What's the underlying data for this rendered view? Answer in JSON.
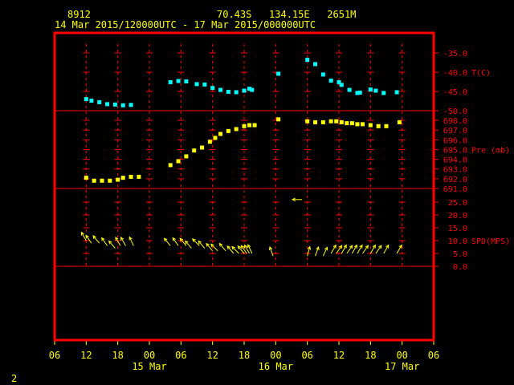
{
  "header": {
    "station_id": "8912",
    "location": "70.43S   134.15E   2651M",
    "time_range": "14 Mar 2015/120000UTC - 17 Mar 2015/000000UTC"
  },
  "footer": {
    "page_number": "2"
  },
  "colors": {
    "frame": "#ff0000",
    "axis_text": "#ffff00",
    "panel_text": "#ff0000",
    "temperature": "#00ffff",
    "pressure": "#ffff00",
    "wind": "#ffff00",
    "background": "#000000"
  },
  "chart_data": {
    "type": "scatter",
    "grid": true,
    "x_axis": {
      "unit": "hours UTC",
      "range": [
        "2015-03-14 06:00",
        "2015-03-17 06:00"
      ],
      "ticks": [
        {
          "time": "2015-03-14 06:00",
          "label": "06"
        },
        {
          "time": "2015-03-14 12:00",
          "label": "12"
        },
        {
          "time": "2015-03-14 18:00",
          "label": "18"
        },
        {
          "time": "2015-03-15 00:00",
          "label": "00"
        },
        {
          "time": "2015-03-15 06:00",
          "label": "06"
        },
        {
          "time": "2015-03-15 12:00",
          "label": "12"
        },
        {
          "time": "2015-03-15 18:00",
          "label": "18"
        },
        {
          "time": "2015-03-16 00:00",
          "label": "00"
        },
        {
          "time": "2015-03-16 06:00",
          "label": "06"
        },
        {
          "time": "2015-03-16 12:00",
          "label": "12"
        },
        {
          "time": "2015-03-16 18:00",
          "label": "18"
        },
        {
          "time": "2015-03-17 00:00",
          "label": "00"
        },
        {
          "time": "2015-03-17 06:00",
          "label": "06"
        }
      ],
      "date_labels": [
        {
          "time": "2015-03-15 00:00",
          "label": "15 Mar"
        },
        {
          "time": "2015-03-16 00:00",
          "label": "16 Mar"
        },
        {
          "time": "2015-03-17 00:00",
          "label": "17 Mar"
        }
      ]
    },
    "panels": [
      {
        "key": "temperature",
        "label": "T(C)",
        "ylim": [
          -50,
          -33
        ],
        "ticks": [
          -35,
          -40,
          -45,
          -50
        ],
        "tick_labels": [
          "-35.0",
          "-40.0",
          "-45.0",
          "-50.0"
        ],
        "series": [
          {
            "time": "2015-03-14 12:00",
            "value": -47.0
          },
          {
            "time": "2015-03-14 13:00",
            "value": -47.4
          },
          {
            "time": "2015-03-14 14:30",
            "value": -47.8
          },
          {
            "time": "2015-03-14 16:00",
            "value": -48.3
          },
          {
            "time": "2015-03-14 17:30",
            "value": -48.4
          },
          {
            "time": "2015-03-14 19:00",
            "value": -48.6
          },
          {
            "time": "2015-03-14 20:30",
            "value": -48.5
          },
          {
            "time": "2015-03-15 04:00",
            "value": -42.6
          },
          {
            "time": "2015-03-15 05:30",
            "value": -42.3
          },
          {
            "time": "2015-03-15 07:00",
            "value": -42.4
          },
          {
            "time": "2015-03-15 09:00",
            "value": -43.1
          },
          {
            "time": "2015-03-15 10:30",
            "value": -43.2
          },
          {
            "time": "2015-03-15 12:00",
            "value": -44.1
          },
          {
            "time": "2015-03-15 13:30",
            "value": -44.6
          },
          {
            "time": "2015-03-15 15:00",
            "value": -45.1
          },
          {
            "time": "2015-03-15 16:30",
            "value": -45.2
          },
          {
            "time": "2015-03-15 18:00",
            "value": -44.8
          },
          {
            "time": "2015-03-15 19:00",
            "value": -44.3
          },
          {
            "time": "2015-03-15 19:30",
            "value": -44.6
          },
          {
            "time": "2015-03-16 00:30",
            "value": -40.4
          },
          {
            "time": "2015-03-16 06:00",
            "value": -36.8
          },
          {
            "time": "2015-03-16 07:30",
            "value": -37.9
          },
          {
            "time": "2015-03-16 09:00",
            "value": -40.6
          },
          {
            "time": "2015-03-16 10:30",
            "value": -42.2
          },
          {
            "time": "2015-03-16 12:00",
            "value": -42.6
          },
          {
            "time": "2015-03-16 12:30",
            "value": -43.3
          },
          {
            "time": "2015-03-16 14:00",
            "value": -44.6
          },
          {
            "time": "2015-03-16 15:30",
            "value": -45.4
          },
          {
            "time": "2015-03-16 16:00",
            "value": -45.3
          },
          {
            "time": "2015-03-16 18:00",
            "value": -44.5
          },
          {
            "time": "2015-03-16 19:00",
            "value": -44.8
          },
          {
            "time": "2015-03-16 20:30",
            "value": -45.4
          },
          {
            "time": "2015-03-16 23:00",
            "value": -45.2
          }
        ]
      },
      {
        "key": "pressure",
        "label": "Pre (mb)",
        "ylim": [
          691,
          698.5
        ],
        "ticks": [
          698,
          697,
          696,
          695,
          694,
          693,
          692,
          691
        ],
        "tick_labels": [
          "698.0",
          "697.0",
          "696.0",
          "695.0",
          "694.0",
          "693.0",
          "692.0",
          "691.0"
        ],
        "series": [
          {
            "time": "2015-03-14 12:00",
            "value": 692.1
          },
          {
            "time": "2015-03-14 13:30",
            "value": 691.8
          },
          {
            "time": "2015-03-14 15:00",
            "value": 691.8
          },
          {
            "time": "2015-03-14 16:30",
            "value": 691.8
          },
          {
            "time": "2015-03-14 18:00",
            "value": 691.9
          },
          {
            "time": "2015-03-14 19:00",
            "value": 692.1
          },
          {
            "time": "2015-03-14 20:30",
            "value": 692.2
          },
          {
            "time": "2015-03-14 22:00",
            "value": 692.2
          },
          {
            "time": "2015-03-15 04:00",
            "value": 693.4
          },
          {
            "time": "2015-03-15 05:30",
            "value": 693.8
          },
          {
            "time": "2015-03-15 07:00",
            "value": 694.3
          },
          {
            "time": "2015-03-15 08:30",
            "value": 694.9
          },
          {
            "time": "2015-03-15 10:00",
            "value": 695.2
          },
          {
            "time": "2015-03-15 11:30",
            "value": 695.8
          },
          {
            "time": "2015-03-15 12:30",
            "value": 696.2
          },
          {
            "time": "2015-03-15 13:30",
            "value": 696.6
          },
          {
            "time": "2015-03-15 15:00",
            "value": 696.9
          },
          {
            "time": "2015-03-15 16:30",
            "value": 697.1
          },
          {
            "time": "2015-03-15 18:00",
            "value": 697.4
          },
          {
            "time": "2015-03-15 19:00",
            "value": 697.5
          },
          {
            "time": "2015-03-15 20:00",
            "value": 697.5
          },
          {
            "time": "2015-03-16 00:30",
            "value": 698.1
          },
          {
            "time": "2015-03-16 06:00",
            "value": 697.9
          },
          {
            "time": "2015-03-16 07:30",
            "value": 697.8
          },
          {
            "time": "2015-03-16 09:00",
            "value": 697.8
          },
          {
            "time": "2015-03-16 10:30",
            "value": 697.9
          },
          {
            "time": "2015-03-16 11:30",
            "value": 697.9
          },
          {
            "time": "2015-03-16 12:30",
            "value": 697.8
          },
          {
            "time": "2015-03-16 13:30",
            "value": 697.7
          },
          {
            "time": "2015-03-16 14:30",
            "value": 697.7
          },
          {
            "time": "2015-03-16 15:30",
            "value": 697.6
          },
          {
            "time": "2015-03-16 16:30",
            "value": 697.6
          },
          {
            "time": "2015-03-16 18:00",
            "value": 697.5
          },
          {
            "time": "2015-03-16 19:30",
            "value": 697.4
          },
          {
            "time": "2015-03-16 21:00",
            "value": 697.4
          },
          {
            "time": "2015-03-16 23:30",
            "value": 697.8
          }
        ]
      },
      {
        "key": "wind",
        "label": "SPD(MPS)",
        "ylim": [
          0,
          29
        ],
        "ticks": [
          25,
          20,
          15,
          10,
          5,
          0
        ],
        "tick_labels": [
          "25.0",
          "20.0",
          "15.0",
          "10.0",
          "5.0",
          "0.0"
        ],
        "direction_convention": "arrow points toward direction wind blows to, degrees clockwise from up",
        "series": [
          {
            "time": "2015-03-14 12:00",
            "speed": 10,
            "dir_to": 330
          },
          {
            "time": "2015-03-14 13:00",
            "speed": 9,
            "dir_to": 325
          },
          {
            "time": "2015-03-14 14:30",
            "speed": 9,
            "dir_to": 320
          },
          {
            "time": "2015-03-14 16:00",
            "speed": 8,
            "dir_to": 325
          },
          {
            "time": "2015-03-14 17:30",
            "speed": 7,
            "dir_to": 320
          },
          {
            "time": "2015-03-14 18:30",
            "speed": 8,
            "dir_to": 330
          },
          {
            "time": "2015-03-14 19:30",
            "speed": 8,
            "dir_to": 330
          },
          {
            "time": "2015-03-14 21:00",
            "speed": 8,
            "dir_to": 335
          },
          {
            "time": "2015-03-15 04:00",
            "speed": 8,
            "dir_to": 320
          },
          {
            "time": "2015-03-15 05:30",
            "speed": 8,
            "dir_to": 325
          },
          {
            "time": "2015-03-15 07:00",
            "speed": 8,
            "dir_to": 320
          },
          {
            "time": "2015-03-15 08:00",
            "speed": 7,
            "dir_to": 320
          },
          {
            "time": "2015-03-15 09:30",
            "speed": 8,
            "dir_to": 315
          },
          {
            "time": "2015-03-15 10:30",
            "speed": 7,
            "dir_to": 320
          },
          {
            "time": "2015-03-15 12:00",
            "speed": 6,
            "dir_to": 320
          },
          {
            "time": "2015-03-15 13:00",
            "speed": 6,
            "dir_to": 315
          },
          {
            "time": "2015-03-15 14:30",
            "speed": 6,
            "dir_to": 320
          },
          {
            "time": "2015-03-15 16:00",
            "speed": 5,
            "dir_to": 320
          },
          {
            "time": "2015-03-15 17:00",
            "speed": 5,
            "dir_to": 315
          },
          {
            "time": "2015-03-15 18:00",
            "speed": 5,
            "dir_to": 320
          },
          {
            "time": "2015-03-15 18:30",
            "speed": 5,
            "dir_to": 325
          },
          {
            "time": "2015-03-15 19:00",
            "speed": 5,
            "dir_to": 330
          },
          {
            "time": "2015-03-15 19:30",
            "speed": 5,
            "dir_to": 335
          },
          {
            "time": "2015-03-15 23:30",
            "speed": 4,
            "dir_to": 340
          },
          {
            "time": "2015-03-16 05:00",
            "speed": 26,
            "dir_to": 270
          },
          {
            "time": "2015-03-16 06:00",
            "speed": 4,
            "dir_to": 15
          },
          {
            "time": "2015-03-16 07:30",
            "speed": 4,
            "dir_to": 20
          },
          {
            "time": "2015-03-16 09:00",
            "speed": 4,
            "dir_to": 25
          },
          {
            "time": "2015-03-16 10:30",
            "speed": 5,
            "dir_to": 30
          },
          {
            "time": "2015-03-16 11:30",
            "speed": 5,
            "dir_to": 35
          },
          {
            "time": "2015-03-16 12:30",
            "speed": 5,
            "dir_to": 30
          },
          {
            "time": "2015-03-16 13:30",
            "speed": 5,
            "dir_to": 35
          },
          {
            "time": "2015-03-16 14:30",
            "speed": 5,
            "dir_to": 30
          },
          {
            "time": "2015-03-16 15:30",
            "speed": 5,
            "dir_to": 30
          },
          {
            "time": "2015-03-16 16:30",
            "speed": 5,
            "dir_to": 35
          },
          {
            "time": "2015-03-16 18:00",
            "speed": 5,
            "dir_to": 30
          },
          {
            "time": "2015-03-16 19:00",
            "speed": 5,
            "dir_to": 35
          },
          {
            "time": "2015-03-16 20:30",
            "speed": 5,
            "dir_to": 30
          },
          {
            "time": "2015-03-16 23:00",
            "speed": 5,
            "dir_to": 30
          }
        ]
      }
    ]
  }
}
